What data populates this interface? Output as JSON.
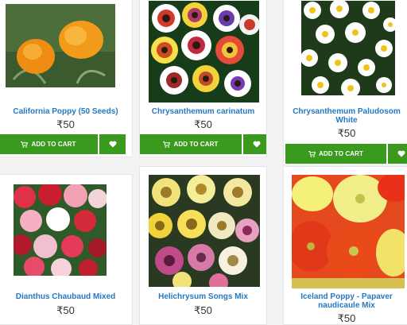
{
  "products": [
    {
      "name": "California Poppy (50 Seeds)",
      "price": "₹50",
      "cart_label": "ADD TO CART",
      "cart_icon": "cart-icon",
      "wish_icon": "heart-icon"
    },
    {
      "name": "Chrysanthemum carinatum",
      "price": "₹50",
      "cart_label": "ADD TO CART",
      "cart_icon": "cart-icon",
      "wish_icon": "heart-icon"
    },
    {
      "name": "Chrysanthemum Paludosom White",
      "price": "₹50",
      "cart_label": "ADD TO CART",
      "cart_icon": "cart-icon",
      "wish_icon": "heart-icon"
    },
    {
      "name": "Dianthus Chaubaud Mixed",
      "price": "₹50"
    },
    {
      "name": "Helichrysum Songs Mix",
      "price": "₹50"
    },
    {
      "name": "Iceland Poppy - Papaver naudicaule Mix",
      "price": "₹50"
    }
  ],
  "colors": {
    "accent_green": "#3a9a1e",
    "title_blue": "#2478c2"
  }
}
